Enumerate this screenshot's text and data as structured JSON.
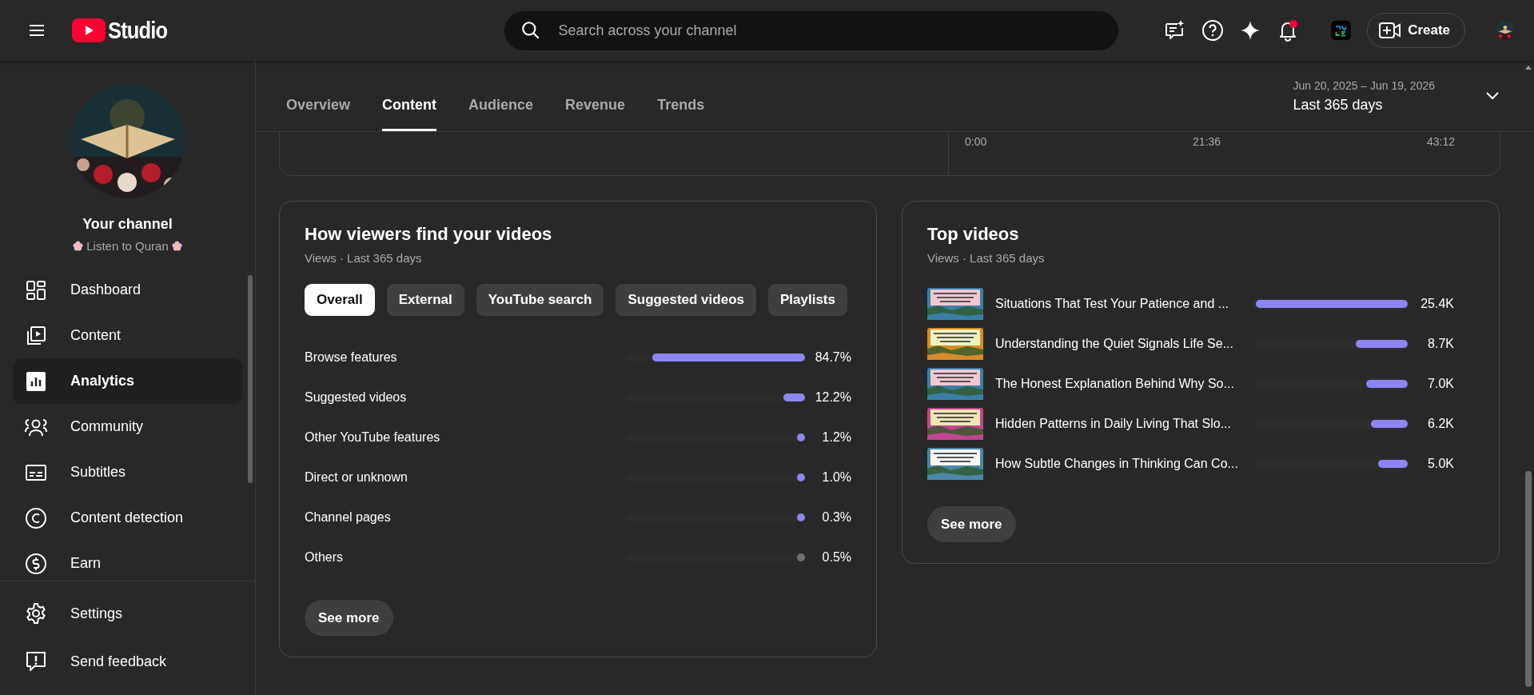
{
  "header": {
    "logo_text": "Studio",
    "search": {
      "placeholder": "Search across your channel"
    },
    "notifications": {
      "unread": true
    },
    "create_button": "Create"
  },
  "sidebar": {
    "channel_title": "Your channel",
    "channel_name": "Listen to Quran",
    "items": [
      {
        "label": "Dashboard",
        "selected": false
      },
      {
        "label": "Content",
        "selected": false
      },
      {
        "label": "Analytics",
        "selected": true
      },
      {
        "label": "Community",
        "selected": false
      },
      {
        "label": "Subtitles",
        "selected": false
      },
      {
        "label": "Content detection",
        "selected": false
      },
      {
        "label": "Earn",
        "selected": false
      }
    ],
    "bottom_items": [
      {
        "label": "Settings"
      },
      {
        "label": "Send feedback"
      }
    ]
  },
  "tabs": [
    {
      "label": "Overview",
      "selected": false
    },
    {
      "label": "Content",
      "selected": true
    },
    {
      "label": "Audience",
      "selected": false
    },
    {
      "label": "Revenue",
      "selected": false
    },
    {
      "label": "Trends",
      "selected": false
    }
  ],
  "date_range": {
    "dates": "Jun 20, 2025 – Jun 19, 2026",
    "label": "Last 365 days"
  },
  "partial_chart": {
    "x_labels": [
      "0:00",
      "21:36",
      "43:12"
    ]
  },
  "traffic_sources": {
    "title": "How viewers find your videos",
    "subtitle": "Views · Last 365 days",
    "filters": [
      {
        "label": "Overall",
        "selected": true
      },
      {
        "label": "External",
        "selected": false
      },
      {
        "label": "YouTube search",
        "selected": false
      },
      {
        "label": "Suggested videos",
        "selected": false
      },
      {
        "label": "Playlists",
        "selected": false
      }
    ],
    "rows": [
      {
        "label": "Browse features",
        "level": 0.847,
        "value": "84.7%",
        "color": "#8c86f5"
      },
      {
        "label": "Suggested videos",
        "level": 0.122,
        "value": "12.2%",
        "color": "#8c86f5"
      },
      {
        "label": "Other YouTube features",
        "level": 0.012,
        "value": "1.2%",
        "color": "#8c86f5"
      },
      {
        "label": "Direct or unknown",
        "level": 0.01,
        "value": "1.0%",
        "color": "#8c86f5"
      },
      {
        "label": "Channel pages",
        "level": 0.003,
        "value": "0.3%",
        "color": "#8c86f5"
      },
      {
        "label": "Others",
        "level": 0.005,
        "value": "0.5%",
        "color": "#717171"
      }
    ],
    "button": "See more"
  },
  "top_videos": {
    "title": "Top videos",
    "subtitle": "Views · Last 365 days",
    "rows": [
      {
        "title": "Situations That Test Your Patience and ...",
        "level": 1,
        "value": "25.4K"
      },
      {
        "title": "Understanding the Quiet Signals Life Se...",
        "level": 0.343,
        "value": "8.7K"
      },
      {
        "title": "The Honest Explanation Behind Why So...",
        "level": 0.276,
        "value": "7.0K"
      },
      {
        "title": "Hidden Patterns in Daily Living That Slo...",
        "level": 0.244,
        "value": "6.2K"
      },
      {
        "title": "How Subtle Changes in Thinking Can Co...",
        "level": 0.197,
        "value": "5.0K"
      }
    ],
    "button": "See more"
  }
}
